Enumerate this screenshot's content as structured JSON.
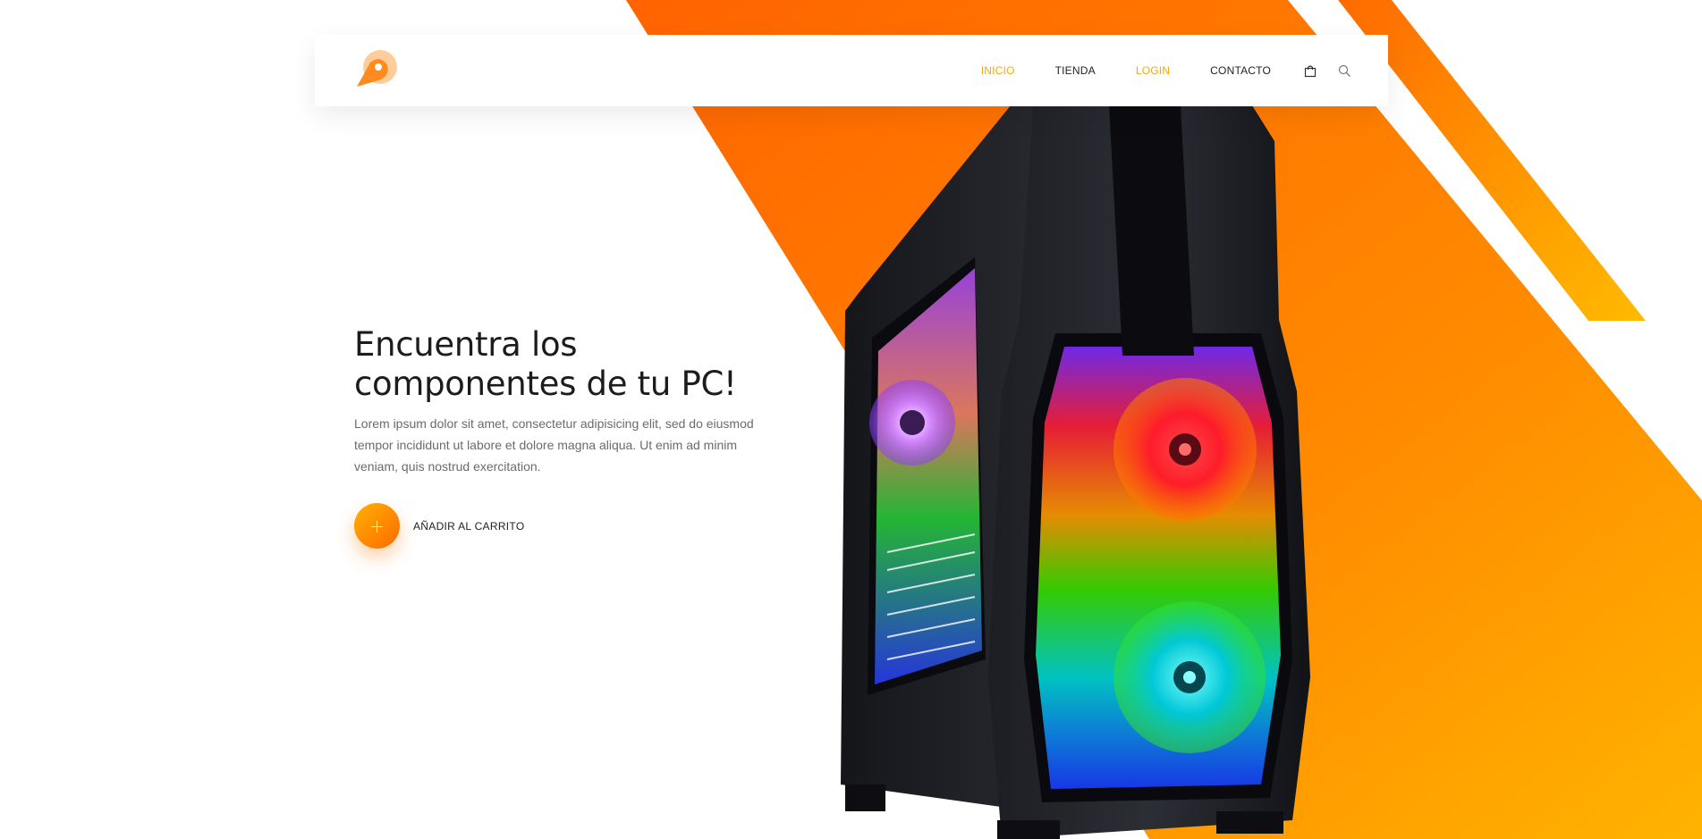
{
  "nav": {
    "links": [
      {
        "label": "INICIO",
        "active": true
      },
      {
        "label": "TIENDA",
        "active": false
      },
      {
        "label": "LOGIN",
        "active": true
      },
      {
        "label": "CONTACTO",
        "active": false
      }
    ],
    "icons": [
      "bag-icon",
      "search-icon"
    ],
    "logo": "location-pin-logo"
  },
  "hero": {
    "title_line1": "Encuentra los",
    "title_line2": "componentes de tu PC!",
    "description": "Lorem ipsum dolor sit amet, consectetur adipisicing elit, sed do eiusmod tempor incididunt ut labore et dolore magna aliqua. Ut enim ad minim veniam, quis nostrud exercitation.",
    "cta_icon": "+",
    "cta_label": "AÑADIR AL CARRITO"
  },
  "colors": {
    "accent": "#f7a70a",
    "orange_dark": "#ff6a00",
    "orange_light": "#ffb100",
    "text": "#222222"
  }
}
